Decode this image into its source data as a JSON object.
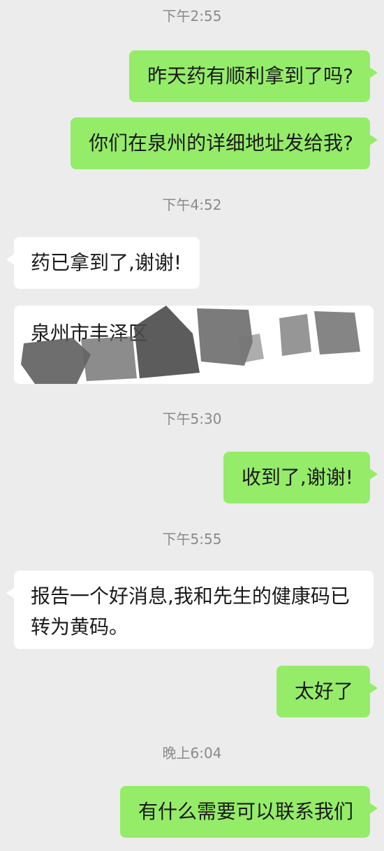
{
  "messages": [
    {
      "type": "timestamp",
      "text": "下午2:55"
    },
    {
      "type": "sent",
      "text": "昨天药有顺利拿到了吗?"
    },
    {
      "type": "sent",
      "text": "你们在泉州的详细地址发给我?"
    },
    {
      "type": "timestamp",
      "text": "下午4:52"
    },
    {
      "type": "received",
      "text": "药已拿到了,谢谢!"
    },
    {
      "type": "received-redacted",
      "text": "泉州市丰泽区"
    },
    {
      "type": "timestamp",
      "text": "下午5:30"
    },
    {
      "type": "sent",
      "text": "收到了,谢谢!"
    },
    {
      "type": "timestamp",
      "text": "下午5:55"
    },
    {
      "type": "received",
      "text": "报告一个好消息,我和先生的健康码已转为黄码。"
    },
    {
      "type": "sent",
      "text": "太好了"
    },
    {
      "type": "timestamp",
      "text": "晚上6:04"
    },
    {
      "type": "sent",
      "text": "有什么需要可以联系我们"
    }
  ],
  "colors": {
    "background": "#ececec",
    "sent_bubble": "#95ec69",
    "received_bubble": "#ffffff",
    "timestamp_text": "#8a8a8a",
    "redaction": "#555555"
  }
}
